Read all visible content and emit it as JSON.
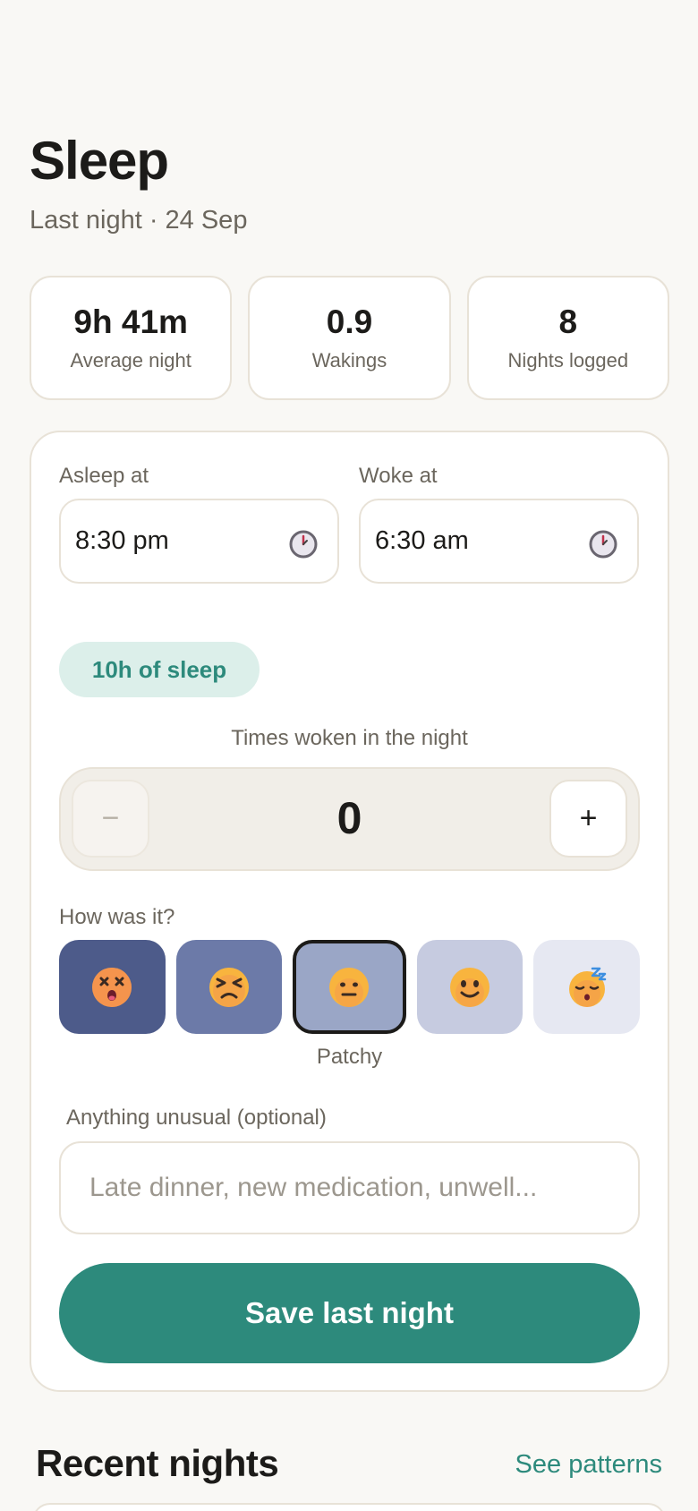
{
  "header": {
    "title": "Sleep",
    "subtitle": "Last night · 24 Sep"
  },
  "stats": [
    {
      "value": "9h 41m",
      "label": "Average night"
    },
    {
      "value": "0.9",
      "label": "Wakings"
    },
    {
      "value": "8",
      "label": "Nights logged"
    }
  ],
  "form": {
    "asleep_label": "Asleep at",
    "asleep_value": "8:30 pm",
    "woke_label": "Woke at",
    "woke_value": "6:30 am",
    "duration": "10h of sleep",
    "woken_label": "Times woken in the night",
    "woken_value": "0",
    "minus_symbol": "−",
    "plus_symbol": "+",
    "quality_label": "How was it?",
    "moods": [
      {
        "icon": "dizzy-face-icon",
        "emoji": "😵",
        "color": "#4d5b8a"
      },
      {
        "icon": "tired-face-icon",
        "emoji": "😣",
        "color": "#6c7aa8"
      },
      {
        "icon": "neutral-face-icon",
        "emoji": "😐",
        "color": "#9aa6c6",
        "selected": true
      },
      {
        "icon": "smiling-face-icon",
        "emoji": "🙂",
        "color": "#c6cbe0"
      },
      {
        "icon": "sleeping-face-icon",
        "emoji": "😴",
        "color": "#e6e8f2"
      }
    ],
    "selected_mood_label": "Patchy",
    "notes_label": "Anything unusual (optional)",
    "notes_placeholder": "Late dinner, new medication, unwell...",
    "save_label": "Save last night"
  },
  "recent": {
    "title": "Recent nights",
    "link": "See patterns"
  },
  "colors": {
    "accent": "#2d8a7c",
    "pill_bg": "#dcefea",
    "border": "#e8e2d7"
  }
}
